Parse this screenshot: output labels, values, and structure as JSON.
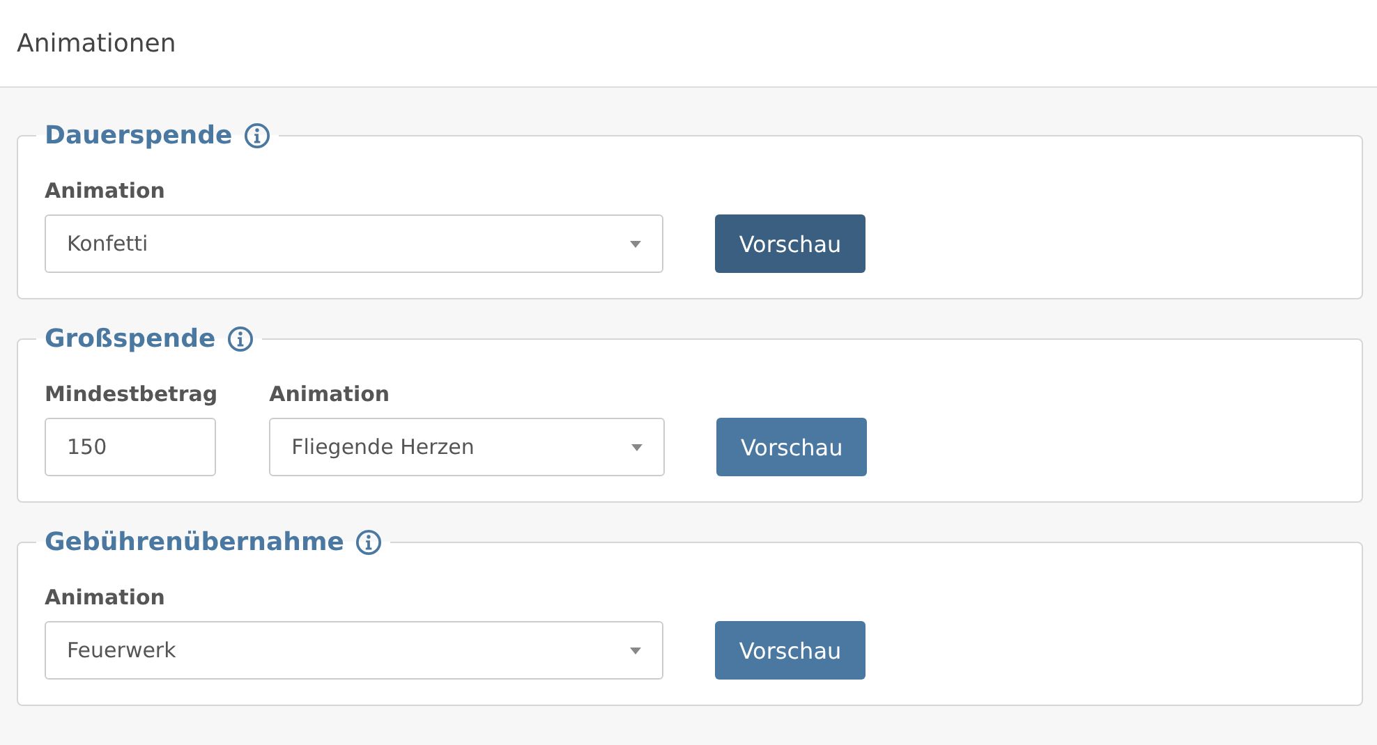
{
  "header": {
    "title": "Animationen"
  },
  "sections": [
    {
      "title": "Dauerspende",
      "info": true,
      "fields": [
        {
          "kind": "select",
          "label": "Animation",
          "value": "Konfetti"
        }
      ],
      "button": {
        "label": "Vorschau",
        "focused": true
      }
    },
    {
      "title": "Großspende",
      "info": true,
      "fields": [
        {
          "kind": "number",
          "label": "Mindestbetrag",
          "value": "150"
        },
        {
          "kind": "select",
          "label": "Animation",
          "value": "Fliegende Herzen"
        }
      ],
      "button": {
        "label": "Vorschau",
        "focused": false
      }
    },
    {
      "title": "Gebührenübernahme",
      "info": true,
      "fields": [
        {
          "kind": "select",
          "label": "Animation",
          "value": "Feuerwerk"
        }
      ],
      "button": {
        "label": "Vorschau",
        "focused": false
      }
    }
  ]
}
